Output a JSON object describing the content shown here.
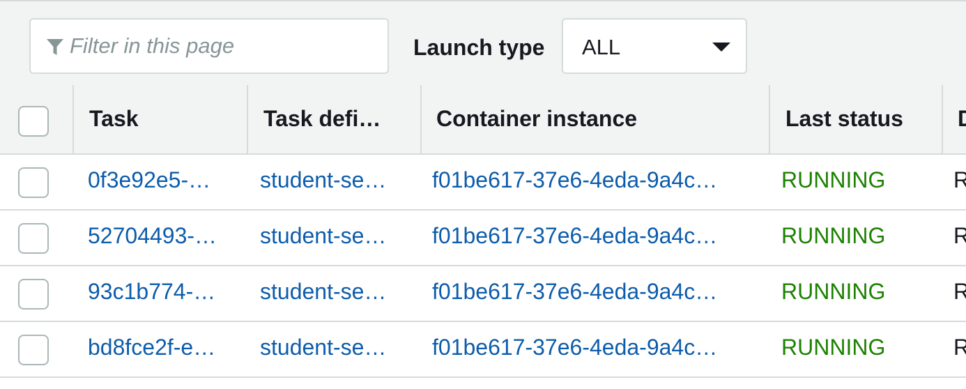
{
  "toolbar": {
    "filter_placeholder": "Filter in this page",
    "launch_type_label": "Launch type",
    "launch_type_value": "ALL"
  },
  "table": {
    "columns": [
      "Task",
      "Task defi…",
      "Container instance",
      "Last status",
      "D"
    ],
    "rows": [
      {
        "task": "0f3e92e5-…",
        "task_definition": "student-se…",
        "container_instance": "f01be617-37e6-4eda-9a4c…",
        "last_status": "RUNNING",
        "desired": "R"
      },
      {
        "task": "52704493-…",
        "task_definition": "student-se…",
        "container_instance": "f01be617-37e6-4eda-9a4c…",
        "last_status": "RUNNING",
        "desired": "R"
      },
      {
        "task": "93c1b774-…",
        "task_definition": "student-se…",
        "container_instance": "f01be617-37e6-4eda-9a4c…",
        "last_status": "RUNNING",
        "desired": "R"
      },
      {
        "task": "bd8fce2f-e…",
        "task_definition": "student-se…",
        "container_instance": "f01be617-37e6-4eda-9a4c…",
        "last_status": "RUNNING",
        "desired": "R"
      }
    ]
  },
  "colors": {
    "link": "#0d5cab",
    "status_running": "#1d8102",
    "header_bg": "#f2f3f3",
    "border": "#d5dbdb"
  },
  "icons": {
    "filter": "funnel-icon",
    "dropdown": "caret-down-icon"
  }
}
